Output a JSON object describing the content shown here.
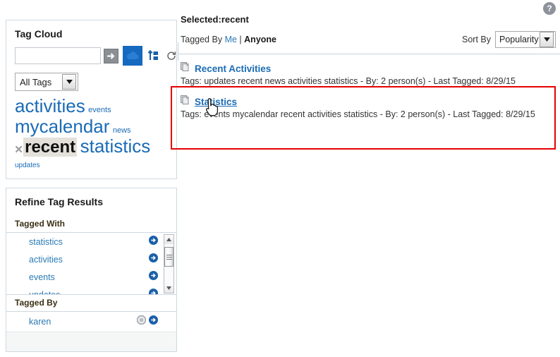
{
  "help": {
    "label": "?",
    "icon": "help-icon"
  },
  "tag_cloud": {
    "title": "Tag Cloud",
    "search_value": "",
    "search_placeholder": "",
    "buttons": {
      "go": "go-arrow-icon",
      "cloud": "cloud-icon",
      "add_tag": "add-tag-icon",
      "refresh": "refresh-icon"
    },
    "filter_select": {
      "value": "All Tags"
    },
    "tags": [
      {
        "label": "activities",
        "size": "xl",
        "selected": false
      },
      {
        "label": "events",
        "size": "sm",
        "selected": false
      },
      {
        "label": "mycalendar",
        "size": "xl",
        "selected": false
      },
      {
        "label": "news",
        "size": "sm",
        "selected": false
      },
      {
        "label": "recent",
        "size": "xl",
        "selected": true
      },
      {
        "label": "statistics",
        "size": "xl",
        "selected": false
      },
      {
        "label": "updates",
        "size": "xs",
        "selected": false
      }
    ],
    "remove_label": "×"
  },
  "refine": {
    "title": "Refine Tag Results",
    "tagged_with_label": "Tagged With",
    "tagged_with": [
      {
        "label": "statistics"
      },
      {
        "label": "activities"
      },
      {
        "label": "events"
      },
      {
        "label": "updates"
      }
    ],
    "tagged_by_label": "Tagged By",
    "tagged_by": [
      {
        "label": "karen"
      }
    ]
  },
  "content": {
    "selected_prefix": "Selected:",
    "selected_tag": "recent",
    "tagged_by_label": "Tagged By",
    "tagged_by_me": "Me",
    "tagged_by_sep": "|",
    "tagged_by_anyone": "Anyone",
    "sort_by_label": "Sort By",
    "sort_by_value": "Popularity",
    "results": [
      {
        "title": "Recent Activities",
        "meta": "Tags: updates recent news activities statistics - By: 2 person(s) - Last Tagged: 8/29/15",
        "hovered": false
      },
      {
        "title": "Statistics",
        "meta": "Tags: events mycalendar recent activities statistics - By: 2 person(s) - Last Tagged: 8/29/15",
        "hovered": true
      }
    ]
  },
  "colors": {
    "link": "#1a6bb5",
    "accent_blue": "#1569bf",
    "highlight_red": "#e60000",
    "panel_border": "#cfd9e0"
  }
}
